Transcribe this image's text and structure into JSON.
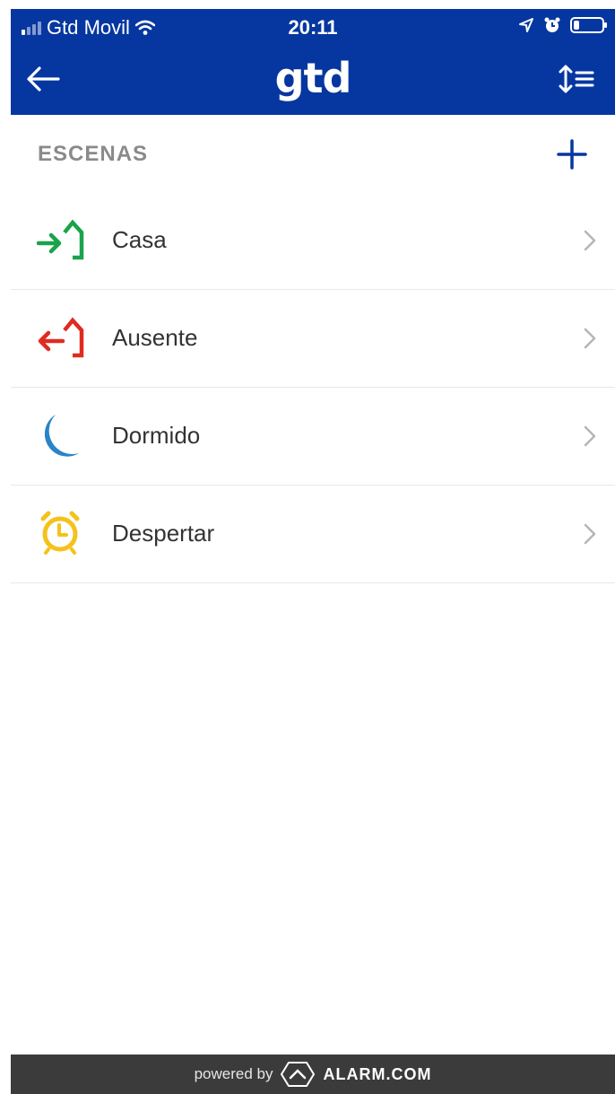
{
  "status_bar": {
    "carrier": "Gtd Movil",
    "time": "20:11",
    "battery_level": 0.2,
    "icons": [
      "signal-icon",
      "wifi-icon",
      "location-icon",
      "alarm-clock-icon",
      "battery-icon"
    ]
  },
  "navbar": {
    "logo": "gtd",
    "back_icon": "arrow-left-icon",
    "sort_icon": "sort-list-icon",
    "background": "#0637a0"
  },
  "section": {
    "title": "ESCENAS",
    "add_icon": "plus-icon"
  },
  "scenes": [
    {
      "label": "Casa",
      "icon": "home-arrive-icon",
      "color": "#1aa34a"
    },
    {
      "label": "Ausente",
      "icon": "home-leave-icon",
      "color": "#e02b20"
    },
    {
      "label": "Dormido",
      "icon": "moon-icon",
      "color": "#2a84c6"
    },
    {
      "label": "Despertar",
      "icon": "alarm-clock-icon",
      "color": "#f4c21b"
    }
  ],
  "footer": {
    "powered_by": "powered by",
    "brand": "ALARM.COM"
  }
}
